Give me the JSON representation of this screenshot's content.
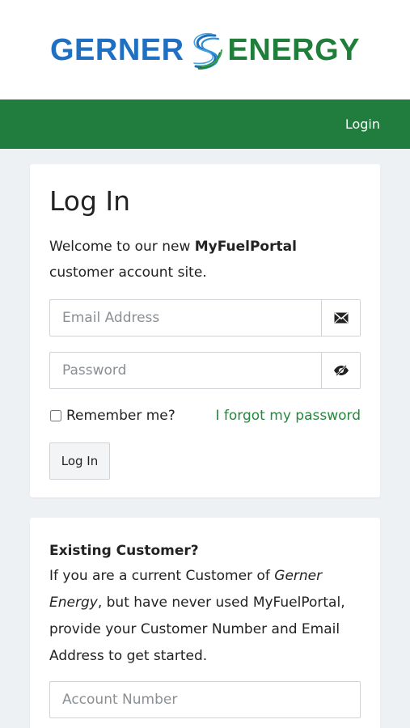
{
  "brand": {
    "left": "GERNER",
    "right": "ENERGY",
    "colors": {
      "blue": "#1f6fc2",
      "green": "#1f7f3a",
      "nav": "#207d3d",
      "link": "#26873f"
    }
  },
  "nav": {
    "login_label": "Login"
  },
  "login_card": {
    "title": "Log In",
    "welcome_pre": "Welcome to our new ",
    "welcome_bold": "MyFuelPortal",
    "welcome_post": " customer account site.",
    "email": {
      "placeholder": "Email Address",
      "value": "",
      "icon": "envelope-icon"
    },
    "password": {
      "placeholder": "Password",
      "value": "",
      "icon": "eye-slash-icon"
    },
    "remember_label": "Remember me?",
    "remember_checked": false,
    "forgot_label": "I forgot my password",
    "submit_label": "Log In"
  },
  "existing_card": {
    "title": "Existing Customer?",
    "text_pre": "If you are a current Customer of ",
    "text_em": "Gerner Energy",
    "text_post": ", but have never used MyFuelPortal, provide your Customer Number and Email Address to get started.",
    "account": {
      "placeholder": "Account Number",
      "value": ""
    }
  }
}
